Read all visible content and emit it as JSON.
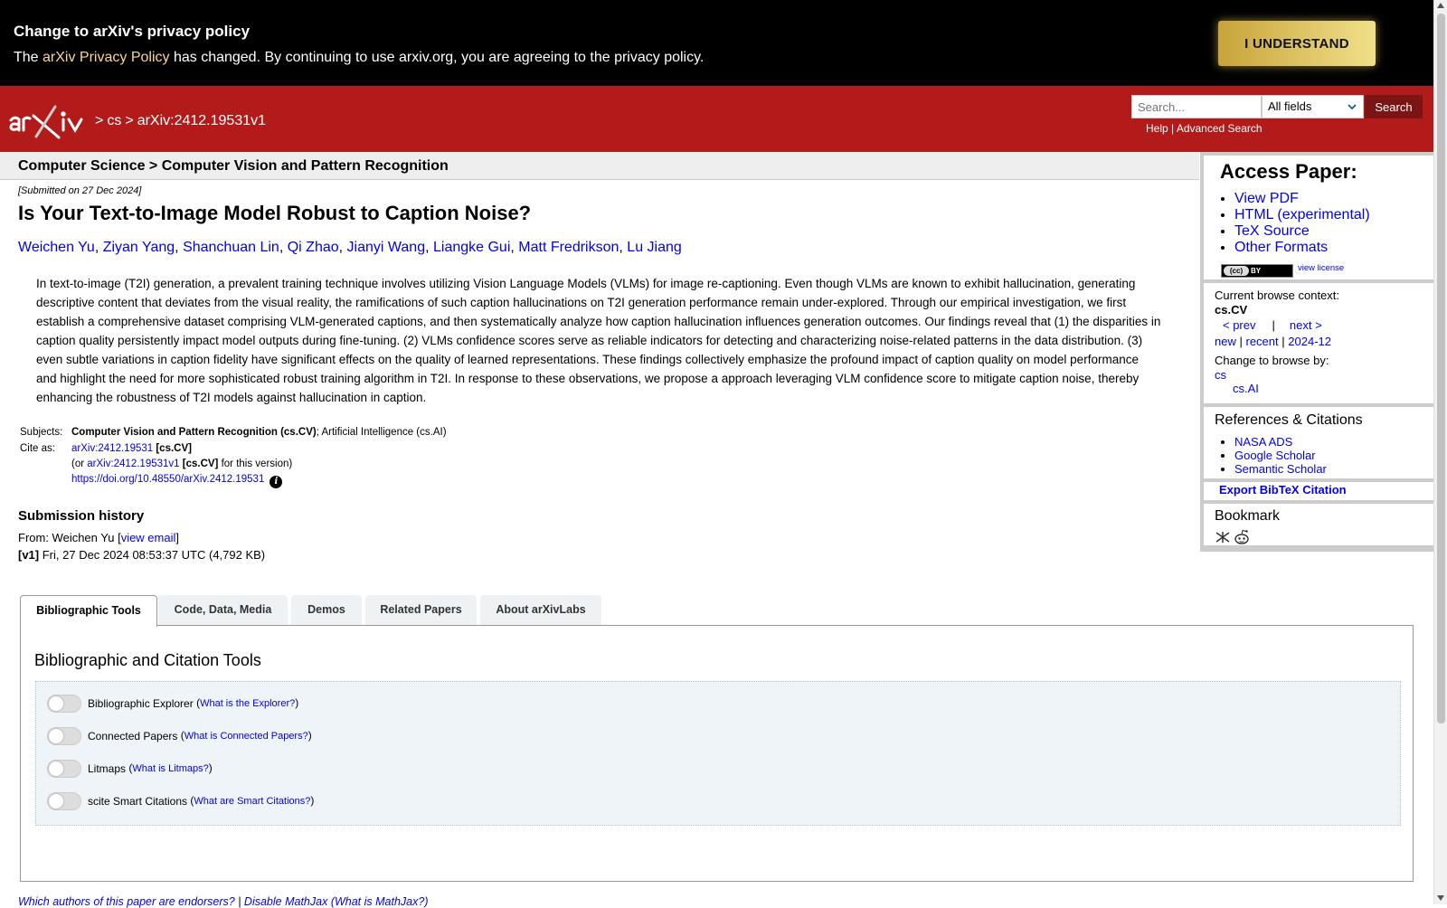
{
  "privacy_banner": {
    "title": "Change to arXiv's privacy policy",
    "text_before": "The ",
    "link_text": "arXiv Privacy Policy",
    "text_after": " has changed. By continuing to use arxiv.org, you are agreeing to the privacy policy.",
    "button_label": "I UNDERSTAND"
  },
  "header": {
    "crumbs": [
      ">",
      "cs",
      ">",
      "arXiv:2412.19531v1"
    ],
    "search_placeholder": "Search...",
    "search_field_selected": "All fields",
    "search_button": "Search",
    "help_link": "Help",
    "links_sep": " | ",
    "advanced_link": "Advanced Search"
  },
  "category_bar": "Computer Science > Computer Vision and Pattern Recognition",
  "paper": {
    "submitted": "[Submitted on 27 Dec 2024]",
    "title": "Is Your Text-to-Image Model Robust to Caption Noise?",
    "authors": [
      "Weichen Yu",
      "Ziyan Yang",
      "Shanchuan Lin",
      "Qi Zhao",
      "Jianyi Wang",
      "Liangke Gui",
      "Matt Fredrikson",
      "Lu Jiang"
    ],
    "abstract": "In text-to-image (T2I) generation, a prevalent training technique involves utilizing Vision Language Models (VLMs) for image re-captioning. Even though VLMs are known to exhibit hallucination, generating descriptive content that deviates from the visual reality, the ramifications of such caption hallucinations on T2I generation performance remain under-explored. Through our empirical investigation, we first establish a comprehensive dataset comprising VLM-generated captions, and then systematically analyze how caption hallucination influences generation outcomes. Our findings reveal that (1) the disparities in caption quality persistently impact model outputs during fine-tuning. (2) VLMs confidence scores serve as reliable indicators for detecting and characterizing noise-related patterns in the data distribution. (3) even subtle variations in caption fidelity have significant effects on the quality of learned representations. These findings collectively emphasize the profound impact of caption quality on model performance and highlight the need for more sophisticated robust training algorithm in T2I. In response to these observations, we propose a approach leveraging VLM confidence score to mitigate caption noise, thereby enhancing the robustness of T2I models against hallucination in caption.",
    "subjects_label": "Subjects:",
    "subjects_primary": "Computer Vision and Pattern Recognition (cs.CV)",
    "subjects_secondary": "; Artificial Intelligence (cs.AI)",
    "cite_label": "Cite as:",
    "cite_id": "arXiv:2412.19531",
    "cite_cat": " [cs.CV]",
    "cite_or_prefix": "(or ",
    "cite_version_id": "arXiv:2412.19531v1",
    "cite_version_cat": " [cs.CV]",
    "cite_version_suffix": " for this version)",
    "doi": "https://doi.org/10.48550/arXiv.2412.19531",
    "info_icon": "i",
    "submission_history_title": "Submission history",
    "from_text": "From: Weichen Yu [",
    "view_email": "view email",
    "from_close": "]",
    "v1_label": "[v1]",
    "v1_text": " Fri, 27 Dec 2024 08:53:37 UTC (4,792 KB)"
  },
  "sidebar": {
    "access_title": "Access Paper:",
    "access_links": [
      "View PDF",
      "HTML (experimental)",
      "TeX Source",
      "Other Formats"
    ],
    "license_badge": "(cc) BY",
    "license_cc": "(cc)",
    "license_by": "BY",
    "view_license": "view license",
    "context_label": "Current browse context:",
    "context_value": "cs.CV",
    "prev": "< prev",
    "pipe": "|",
    "next": "next >",
    "new": "new",
    "recent": "recent",
    "month": "2024-12",
    "change_label": "Change to browse by:",
    "browse_cs": "cs",
    "browse_csai": "cs.AI",
    "refs_title": "References & Citations",
    "refs_links": [
      "NASA ADS",
      "Google Scholar",
      "Semantic Scholar"
    ],
    "bibtex": "Export BibTeX Citation",
    "bookmark_title": "Bookmark"
  },
  "labs": {
    "tabs": [
      "Bibliographic Tools",
      "Code, Data, Media",
      "Demos",
      "Related Papers",
      "About arXivLabs"
    ],
    "active_tab": 0,
    "panel_title": "Bibliographic and Citation Tools",
    "toggles": [
      {
        "label": "Bibliographic Explorer",
        "link": "What is the Explorer?"
      },
      {
        "label": "Connected Papers",
        "link": "What is Connected Papers?"
      },
      {
        "label": "Litmaps",
        "link": "What is Litmaps?"
      },
      {
        "label": "scite Smart Citations",
        "link": "What are Smart Citations?"
      }
    ]
  },
  "footer": {
    "endorsers": "Which authors of this paper are endorsers?",
    "sep": " | ",
    "mathjax": "Disable MathJax",
    "mathjax_what": "(What is MathJax?)"
  },
  "colors": {
    "header_red": "#b31b1b",
    "banner_black": "#000000",
    "link_blue": "#0000ee",
    "banner_link": "#fdd783"
  }
}
